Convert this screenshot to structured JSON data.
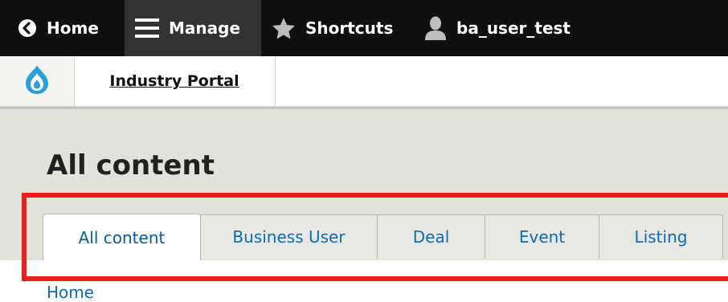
{
  "toolbar": {
    "home_label": "Home",
    "manage_label": "Manage",
    "shortcuts_label": "Shortcuts",
    "user_label": "ba_user_test"
  },
  "site": {
    "name": "Industry Portal"
  },
  "page": {
    "title": "All content"
  },
  "tabs": [
    {
      "label": "All content",
      "active": true
    },
    {
      "label": "Business User",
      "active": false
    },
    {
      "label": "Deal",
      "active": false
    },
    {
      "label": "Event",
      "active": false
    },
    {
      "label": "Listing",
      "active": false
    }
  ],
  "breadcrumb": {
    "home_label": "Home"
  },
  "colors": {
    "toolbar_bg": "#0f0f0f",
    "link_blue": "#0b6bb8",
    "highlight_red": "#f11b1b",
    "drupal_blue": "#2a9fd8"
  }
}
